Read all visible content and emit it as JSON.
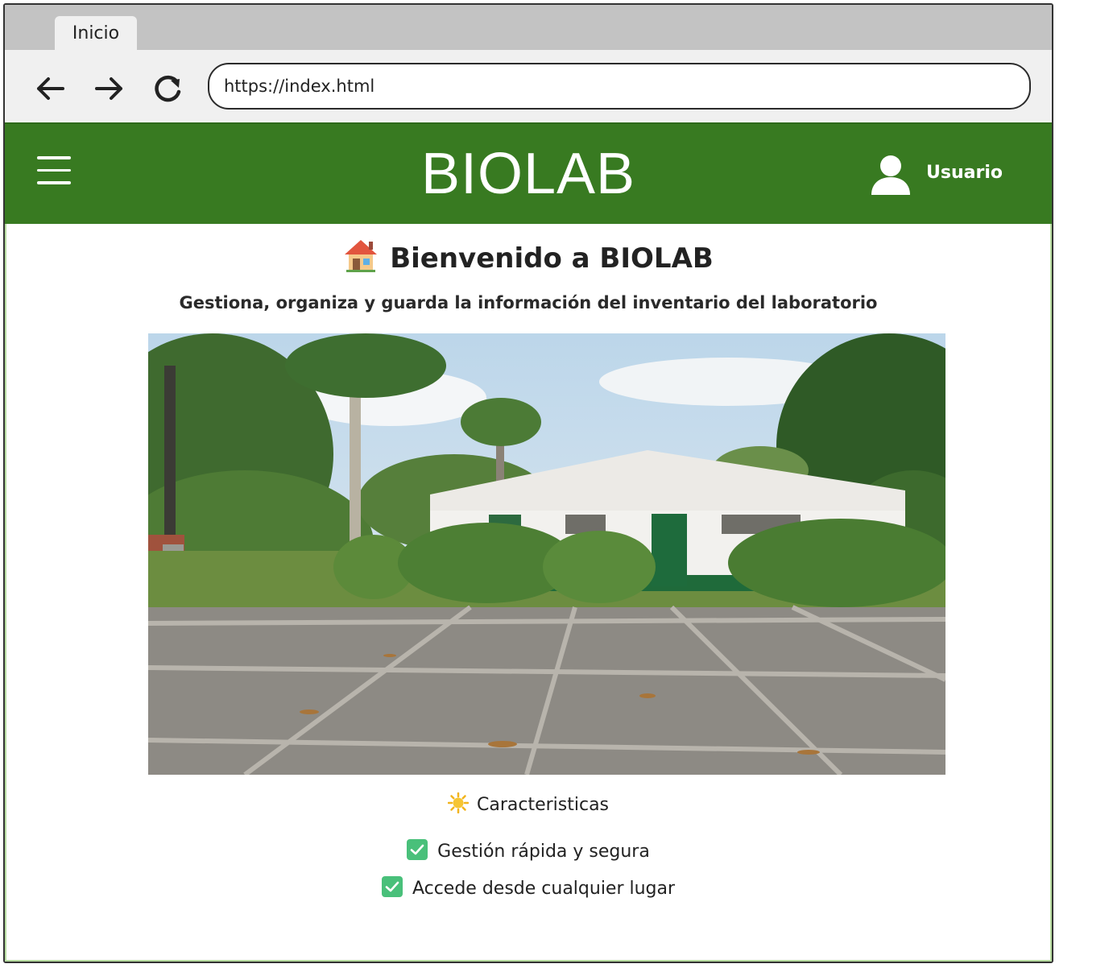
{
  "browser": {
    "tab_label": "Inicio",
    "url": "https://index.html",
    "icons": [
      "back-arrow-icon",
      "forward-arrow-icon",
      "reload-icon"
    ]
  },
  "header": {
    "brand": "BIOLAB",
    "user_label": "Usuario",
    "background_color": "#387a21",
    "icons": [
      "hamburger-menu-icon",
      "user-icon"
    ]
  },
  "main": {
    "welcome_emoji": "house-icon",
    "welcome_title": "Bienvenido a BIOLAB",
    "subtitle": "Gestiona, organiza y guarda la información del inventario del laboratorio",
    "hero_image": "photo of a white one-story laboratory building with green door, hedges, palm trees and a concrete courtyard",
    "features_title": "Caracteristicas",
    "features": [
      {
        "icon": "check-mark-icon",
        "label": "Gestión rápida y segura"
      },
      {
        "icon": "check-mark-icon",
        "label": "Accede desde cualquier lugar"
      }
    ]
  }
}
